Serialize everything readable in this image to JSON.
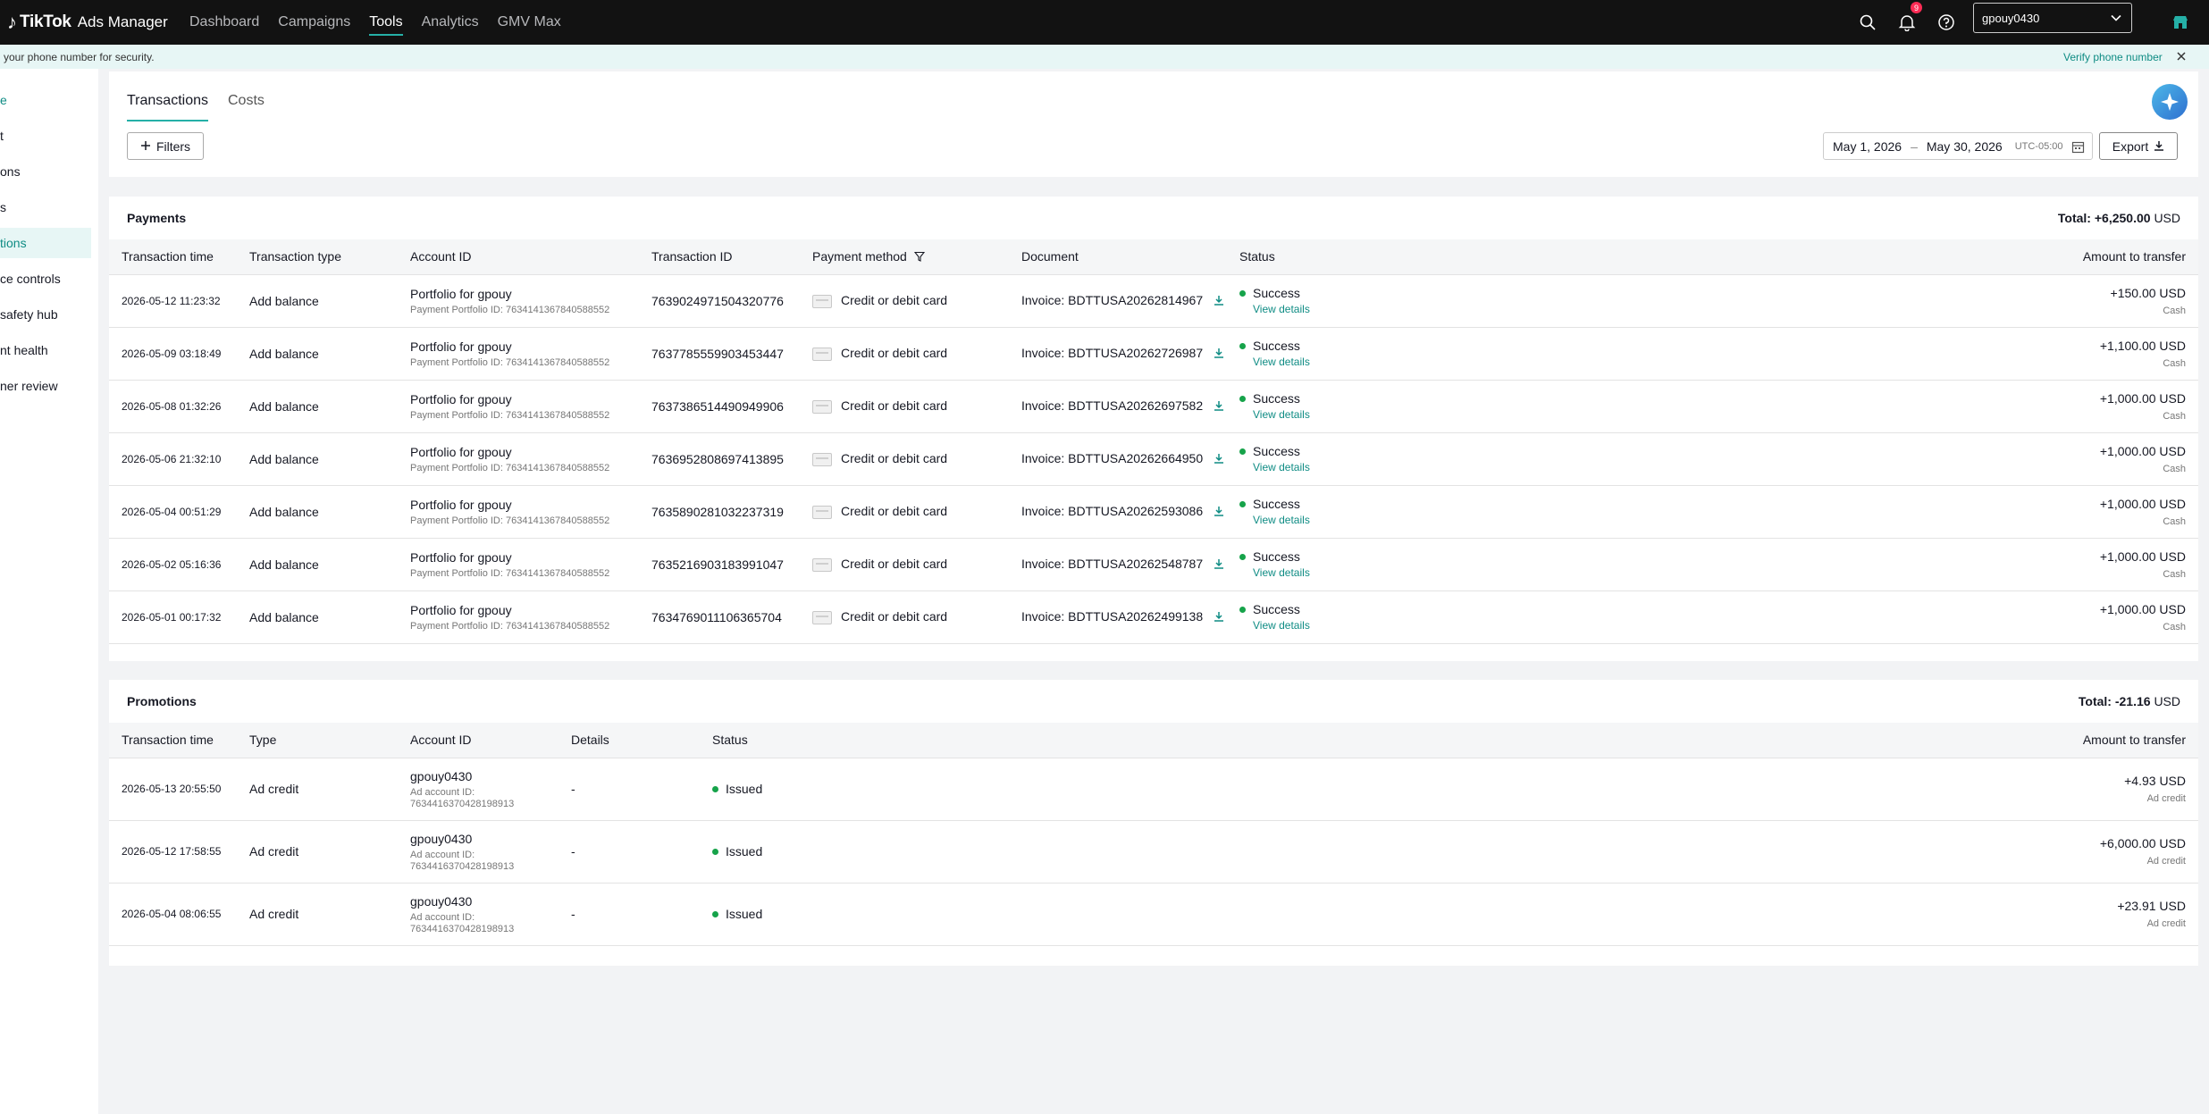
{
  "topbar": {
    "brand_mark": "♪",
    "brand": "TikTok",
    "product": "Ads Manager",
    "nav": [
      "Dashboard",
      "Campaigns",
      "Tools",
      "Analytics",
      "GMV Max"
    ],
    "active_nav": "Tools",
    "notification_count": "9",
    "account": "gpouy0430"
  },
  "banner": {
    "message": "your phone number for security.",
    "action": "Verify phone number"
  },
  "sidebar": {
    "items": [
      "e",
      "t",
      "ons",
      "s",
      "tions",
      "ce controls",
      "safety hub",
      "nt health",
      "ner review"
    ],
    "active_index": 4
  },
  "tabs": [
    "Transactions",
    "Costs"
  ],
  "toolbar": {
    "filters_label": "Filters",
    "date_start": "May 1, 2026",
    "date_sep": "–",
    "date_end": "May 30, 2026",
    "timezone": "UTC-05:00",
    "export_label": "Export"
  },
  "payments": {
    "title": "Payments",
    "total_label": "Total: +6,250.00",
    "total_unit": "USD",
    "columns": [
      "Transaction time",
      "Transaction type",
      "Account ID",
      "Transaction ID",
      "Payment method",
      "Document",
      "Status",
      "Amount to transfer"
    ],
    "rows": [
      {
        "time": "2026-05-12 11:23:32",
        "type": "Add balance",
        "account": "Portfolio for gpouy",
        "account_sub": "Payment Portfolio ID: 7634141367840588552",
        "txn": "7639024971504320776",
        "method": "Credit or debit card",
        "doc": "Invoice: BDTTUSA20262814967",
        "status": "Success",
        "details": "View details",
        "amount": "+150.00 USD",
        "amount_sub": "Cash"
      },
      {
        "time": "2026-05-09 03:18:49",
        "type": "Add balance",
        "account": "Portfolio for gpouy",
        "account_sub": "Payment Portfolio ID: 7634141367840588552",
        "txn": "7637785559903453447",
        "method": "Credit or debit card",
        "doc": "Invoice: BDTTUSA20262726987",
        "status": "Success",
        "details": "View details",
        "amount": "+1,100.00 USD",
        "amount_sub": "Cash"
      },
      {
        "time": "2026-05-08 01:32:26",
        "type": "Add balance",
        "account": "Portfolio for gpouy",
        "account_sub": "Payment Portfolio ID: 7634141367840588552",
        "txn": "7637386514490949906",
        "method": "Credit or debit card",
        "doc": "Invoice: BDTTUSA20262697582",
        "status": "Success",
        "details": "View details",
        "amount": "+1,000.00 USD",
        "amount_sub": "Cash"
      },
      {
        "time": "2026-05-06 21:32:10",
        "type": "Add balance",
        "account": "Portfolio for gpouy",
        "account_sub": "Payment Portfolio ID: 7634141367840588552",
        "txn": "7636952808697413895",
        "method": "Credit or debit card",
        "doc": "Invoice: BDTTUSA20262664950",
        "status": "Success",
        "details": "View details",
        "amount": "+1,000.00 USD",
        "amount_sub": "Cash"
      },
      {
        "time": "2026-05-04 00:51:29",
        "type": "Add balance",
        "account": "Portfolio for gpouy",
        "account_sub": "Payment Portfolio ID: 7634141367840588552",
        "txn": "7635890281032237319",
        "method": "Credit or debit card",
        "doc": "Invoice: BDTTUSA20262593086",
        "status": "Success",
        "details": "View details",
        "amount": "+1,000.00 USD",
        "amount_sub": "Cash"
      },
      {
        "time": "2026-05-02 05:16:36",
        "type": "Add balance",
        "account": "Portfolio for gpouy",
        "account_sub": "Payment Portfolio ID: 7634141367840588552",
        "txn": "7635216903183991047",
        "method": "Credit or debit card",
        "doc": "Invoice: BDTTUSA20262548787",
        "status": "Success",
        "details": "View details",
        "amount": "+1,000.00 USD",
        "amount_sub": "Cash"
      },
      {
        "time": "2026-05-01 00:17:32",
        "type": "Add balance",
        "account": "Portfolio for gpouy",
        "account_sub": "Payment Portfolio ID: 7634141367840588552",
        "txn": "7634769011106365704",
        "method": "Credit or debit card",
        "doc": "Invoice: BDTTUSA20262499138",
        "status": "Success",
        "details": "View details",
        "amount": "+1,000.00 USD",
        "amount_sub": "Cash"
      }
    ]
  },
  "promotions": {
    "title": "Promotions",
    "total_label": "Total: -21.16",
    "total_unit": "USD",
    "columns": [
      "Transaction time",
      "Type",
      "Account ID",
      "Details",
      "Status",
      "Amount to transfer"
    ],
    "rows": [
      {
        "time": "2026-05-13 20:55:50",
        "type": "Ad credit",
        "account": "gpouy0430",
        "account_sub1": "Ad account ID:",
        "account_sub2": "7634416370428198913",
        "details": "-",
        "status": "Issued",
        "amount": "+4.93 USD",
        "amount_sub": "Ad credit"
      },
      {
        "time": "2026-05-12 17:58:55",
        "type": "Ad credit",
        "account": "gpouy0430",
        "account_sub1": "Ad account ID:",
        "account_sub2": "7634416370428198913",
        "details": "-",
        "status": "Issued",
        "amount": "+6,000.00 USD",
        "amount_sub": "Ad credit"
      },
      {
        "time": "2026-05-04 08:06:55",
        "type": "Ad credit",
        "account": "gpouy0430",
        "account_sub1": "Ad account ID:",
        "account_sub2": "7634416370428198913",
        "details": "-",
        "status": "Issued",
        "amount": "+23.91 USD",
        "amount_sub": "Ad credit"
      }
    ]
  },
  "colors": {
    "accent": "#25b0a7",
    "success": "#16a34a",
    "topbar": "#121212"
  }
}
